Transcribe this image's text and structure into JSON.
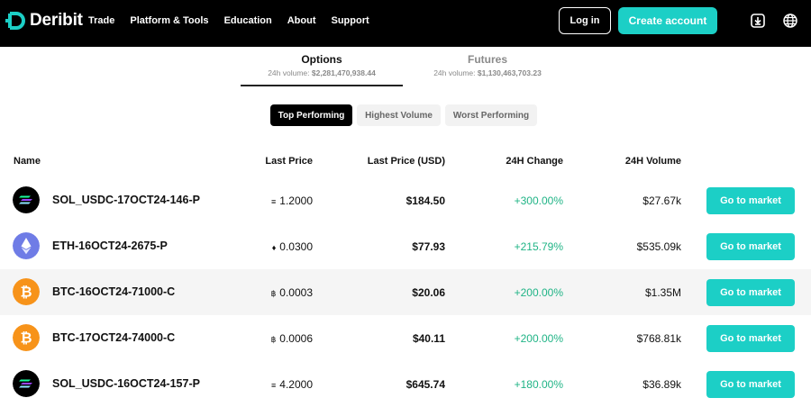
{
  "nav": {
    "logo_text": "Deribit",
    "links": [
      "Trade",
      "Platform & Tools",
      "Education",
      "About",
      "Support"
    ],
    "login_label": "Log in",
    "create_label": "Create account",
    "accent_color": "#1ccfc6"
  },
  "tabs": [
    {
      "label": "Options",
      "volume_prefix": "24h volume:",
      "volume": "$2,281,470,938.44",
      "active": true
    },
    {
      "label": "Futures",
      "volume_prefix": "24h volume:",
      "volume": "$1,130,463,703.23",
      "active": false
    }
  ],
  "filters": [
    {
      "label": "Top Performing",
      "active": true
    },
    {
      "label": "Highest Volume",
      "active": false
    },
    {
      "label": "Worst Performing",
      "active": false
    }
  ],
  "columns": [
    "Name",
    "Last Price",
    "Last Price (USD)",
    "24H Change",
    "24H Volume"
  ],
  "rows": [
    {
      "coin": "SOL",
      "icon": "solana-icon",
      "instrument": "SOL_USDC-17OCT24-146-P",
      "price_symbol": "≡",
      "last_price": "1.2000",
      "last_price_usd": "$184.50",
      "change": "+300.00%",
      "volume": "$27.67k",
      "button": "Go to market"
    },
    {
      "coin": "ETH",
      "icon": "ethereum-icon",
      "instrument": "ETH-16OCT24-2675-P",
      "price_symbol": "♦",
      "last_price": "0.0300",
      "last_price_usd": "$77.93",
      "change": "+215.79%",
      "volume": "$535.09k",
      "button": "Go to market"
    },
    {
      "coin": "BTC",
      "icon": "bitcoin-icon",
      "instrument": "BTC-16OCT24-71000-C",
      "price_symbol": "฿",
      "last_price": "0.0003",
      "last_price_usd": "$20.06",
      "change": "+200.00%",
      "volume": "$1.35M",
      "button": "Go to market"
    },
    {
      "coin": "BTC",
      "icon": "bitcoin-icon",
      "instrument": "BTC-17OCT24-74000-C",
      "price_symbol": "฿",
      "last_price": "0.0006",
      "last_price_usd": "$40.11",
      "change": "+200.00%",
      "volume": "$768.81k",
      "button": "Go to market"
    },
    {
      "coin": "SOL",
      "icon": "solana-icon",
      "instrument": "SOL_USDC-16OCT24-157-P",
      "price_symbol": "≡",
      "last_price": "4.2000",
      "last_price_usd": "$645.74",
      "change": "+180.00%",
      "volume": "$36.89k",
      "button": "Go to market"
    }
  ]
}
